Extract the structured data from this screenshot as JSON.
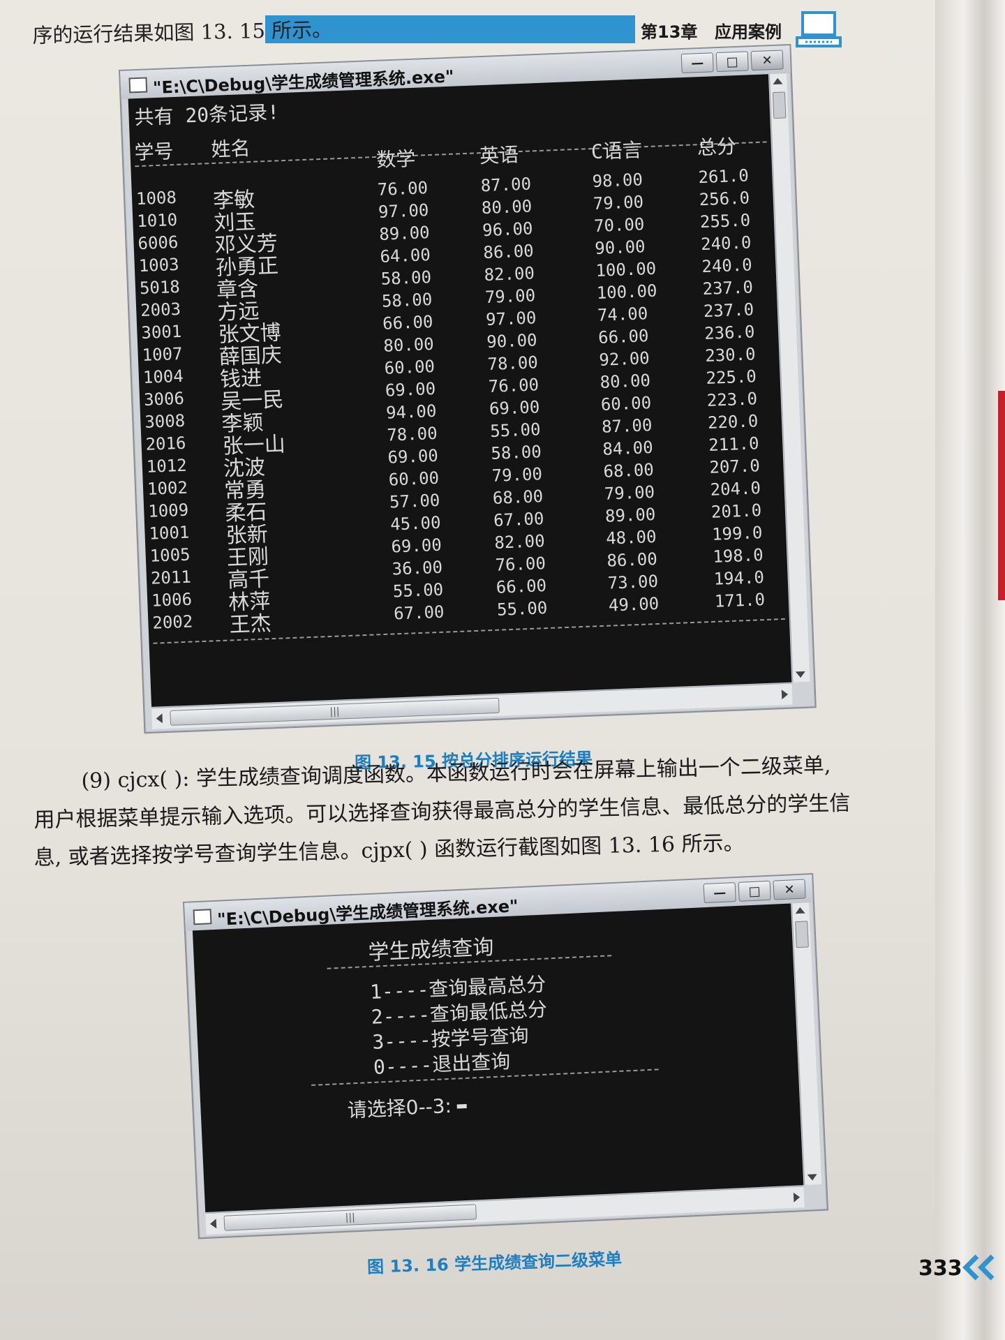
{
  "header": {
    "chapter": "第13章",
    "title": "应用案例",
    "icon": "laptop-icon"
  },
  "intro_text": "序的运行结果如图 13. 15 所示。",
  "window1": {
    "title": "\"E:\\C\\Debug\\学生成绩管理系统.exe\"",
    "controls": {
      "minimize": "—",
      "maximize": "□",
      "close": "✕"
    },
    "count_line": "共有 20条记录!",
    "columns": [
      "学号",
      "姓名",
      "数学",
      "英语",
      "C语言",
      "总分"
    ],
    "rows": [
      [
        "1008",
        "李敏",
        "76.00",
        "87.00",
        "98.00",
        "261.0"
      ],
      [
        "1010",
        "刘玉",
        "97.00",
        "80.00",
        "79.00",
        "256.0"
      ],
      [
        "6006",
        "邓义芳",
        "89.00",
        "96.00",
        "70.00",
        "255.0"
      ],
      [
        "1003",
        "孙勇正",
        "64.00",
        "86.00",
        "90.00",
        "240.0"
      ],
      [
        "5018",
        "章含",
        "58.00",
        "82.00",
        "100.00",
        "240.0"
      ],
      [
        "2003",
        "方远",
        "58.00",
        "79.00",
        "100.00",
        "237.0"
      ],
      [
        "3001",
        "张文博",
        "66.00",
        "97.00",
        "74.00",
        "237.0"
      ],
      [
        "1007",
        "薛国庆",
        "80.00",
        "90.00",
        "66.00",
        "236.0"
      ],
      [
        "1004",
        "钱进",
        "60.00",
        "78.00",
        "92.00",
        "230.0"
      ],
      [
        "3006",
        "吴一民",
        "69.00",
        "76.00",
        "80.00",
        "225.0"
      ],
      [
        "3008",
        "李颖",
        "94.00",
        "69.00",
        "60.00",
        "223.0"
      ],
      [
        "2016",
        "张一山",
        "78.00",
        "55.00",
        "87.00",
        "220.0"
      ],
      [
        "1012",
        "沈波",
        "69.00",
        "58.00",
        "84.00",
        "211.0"
      ],
      [
        "1002",
        "常勇",
        "60.00",
        "79.00",
        "68.00",
        "207.0"
      ],
      [
        "1009",
        "柔石",
        "57.00",
        "68.00",
        "79.00",
        "204.0"
      ],
      [
        "1001",
        "张新",
        "45.00",
        "67.00",
        "89.00",
        "201.0"
      ],
      [
        "1005",
        "王刚",
        "69.00",
        "82.00",
        "48.00",
        "199.0"
      ],
      [
        "2011",
        "高千",
        "36.00",
        "76.00",
        "86.00",
        "198.0"
      ],
      [
        "1006",
        "林萍",
        "55.00",
        "66.00",
        "73.00",
        "194.0"
      ],
      [
        "2002",
        "王杰",
        "67.00",
        "55.00",
        "49.00",
        "171.0"
      ]
    ]
  },
  "caption1": "图 13. 15   按总分排序运行结果",
  "paragraph": {
    "line1": "(9) cjcx( ): 学生成绩查询调度函数。本函数运行时会在屏幕上输出一个二级菜单,",
    "line2": "用户根据菜单提示输入选项。可以选择查询获得最高总分的学生信息、最低总分的学生信",
    "line3": "息, 或者选择按学号查询学生信息。cjpx( ) 函数运行截图如图 13. 16 所示。"
  },
  "window2": {
    "title": "\"E:\\C\\Debug\\学生成绩管理系统.exe\"",
    "controls": {
      "minimize": "—",
      "maximize": "□",
      "close": "✕"
    },
    "menu_title": "学生成绩查询",
    "menu_items": [
      {
        "key": "1----",
        "text": "查询最高总分"
      },
      {
        "key": "2----",
        "text": "查询最低总分"
      },
      {
        "key": "3----",
        "text": "按学号查询"
      },
      {
        "key": "0----",
        "text": "退出查询"
      }
    ],
    "prompt": "请选择0--3:"
  },
  "caption2": "图 13. 16   学生成绩查询二级菜单",
  "page_number": "333",
  "colors": {
    "accent": "#2f93cf",
    "caption": "#1d7fc1",
    "console_bg": "#141414"
  }
}
